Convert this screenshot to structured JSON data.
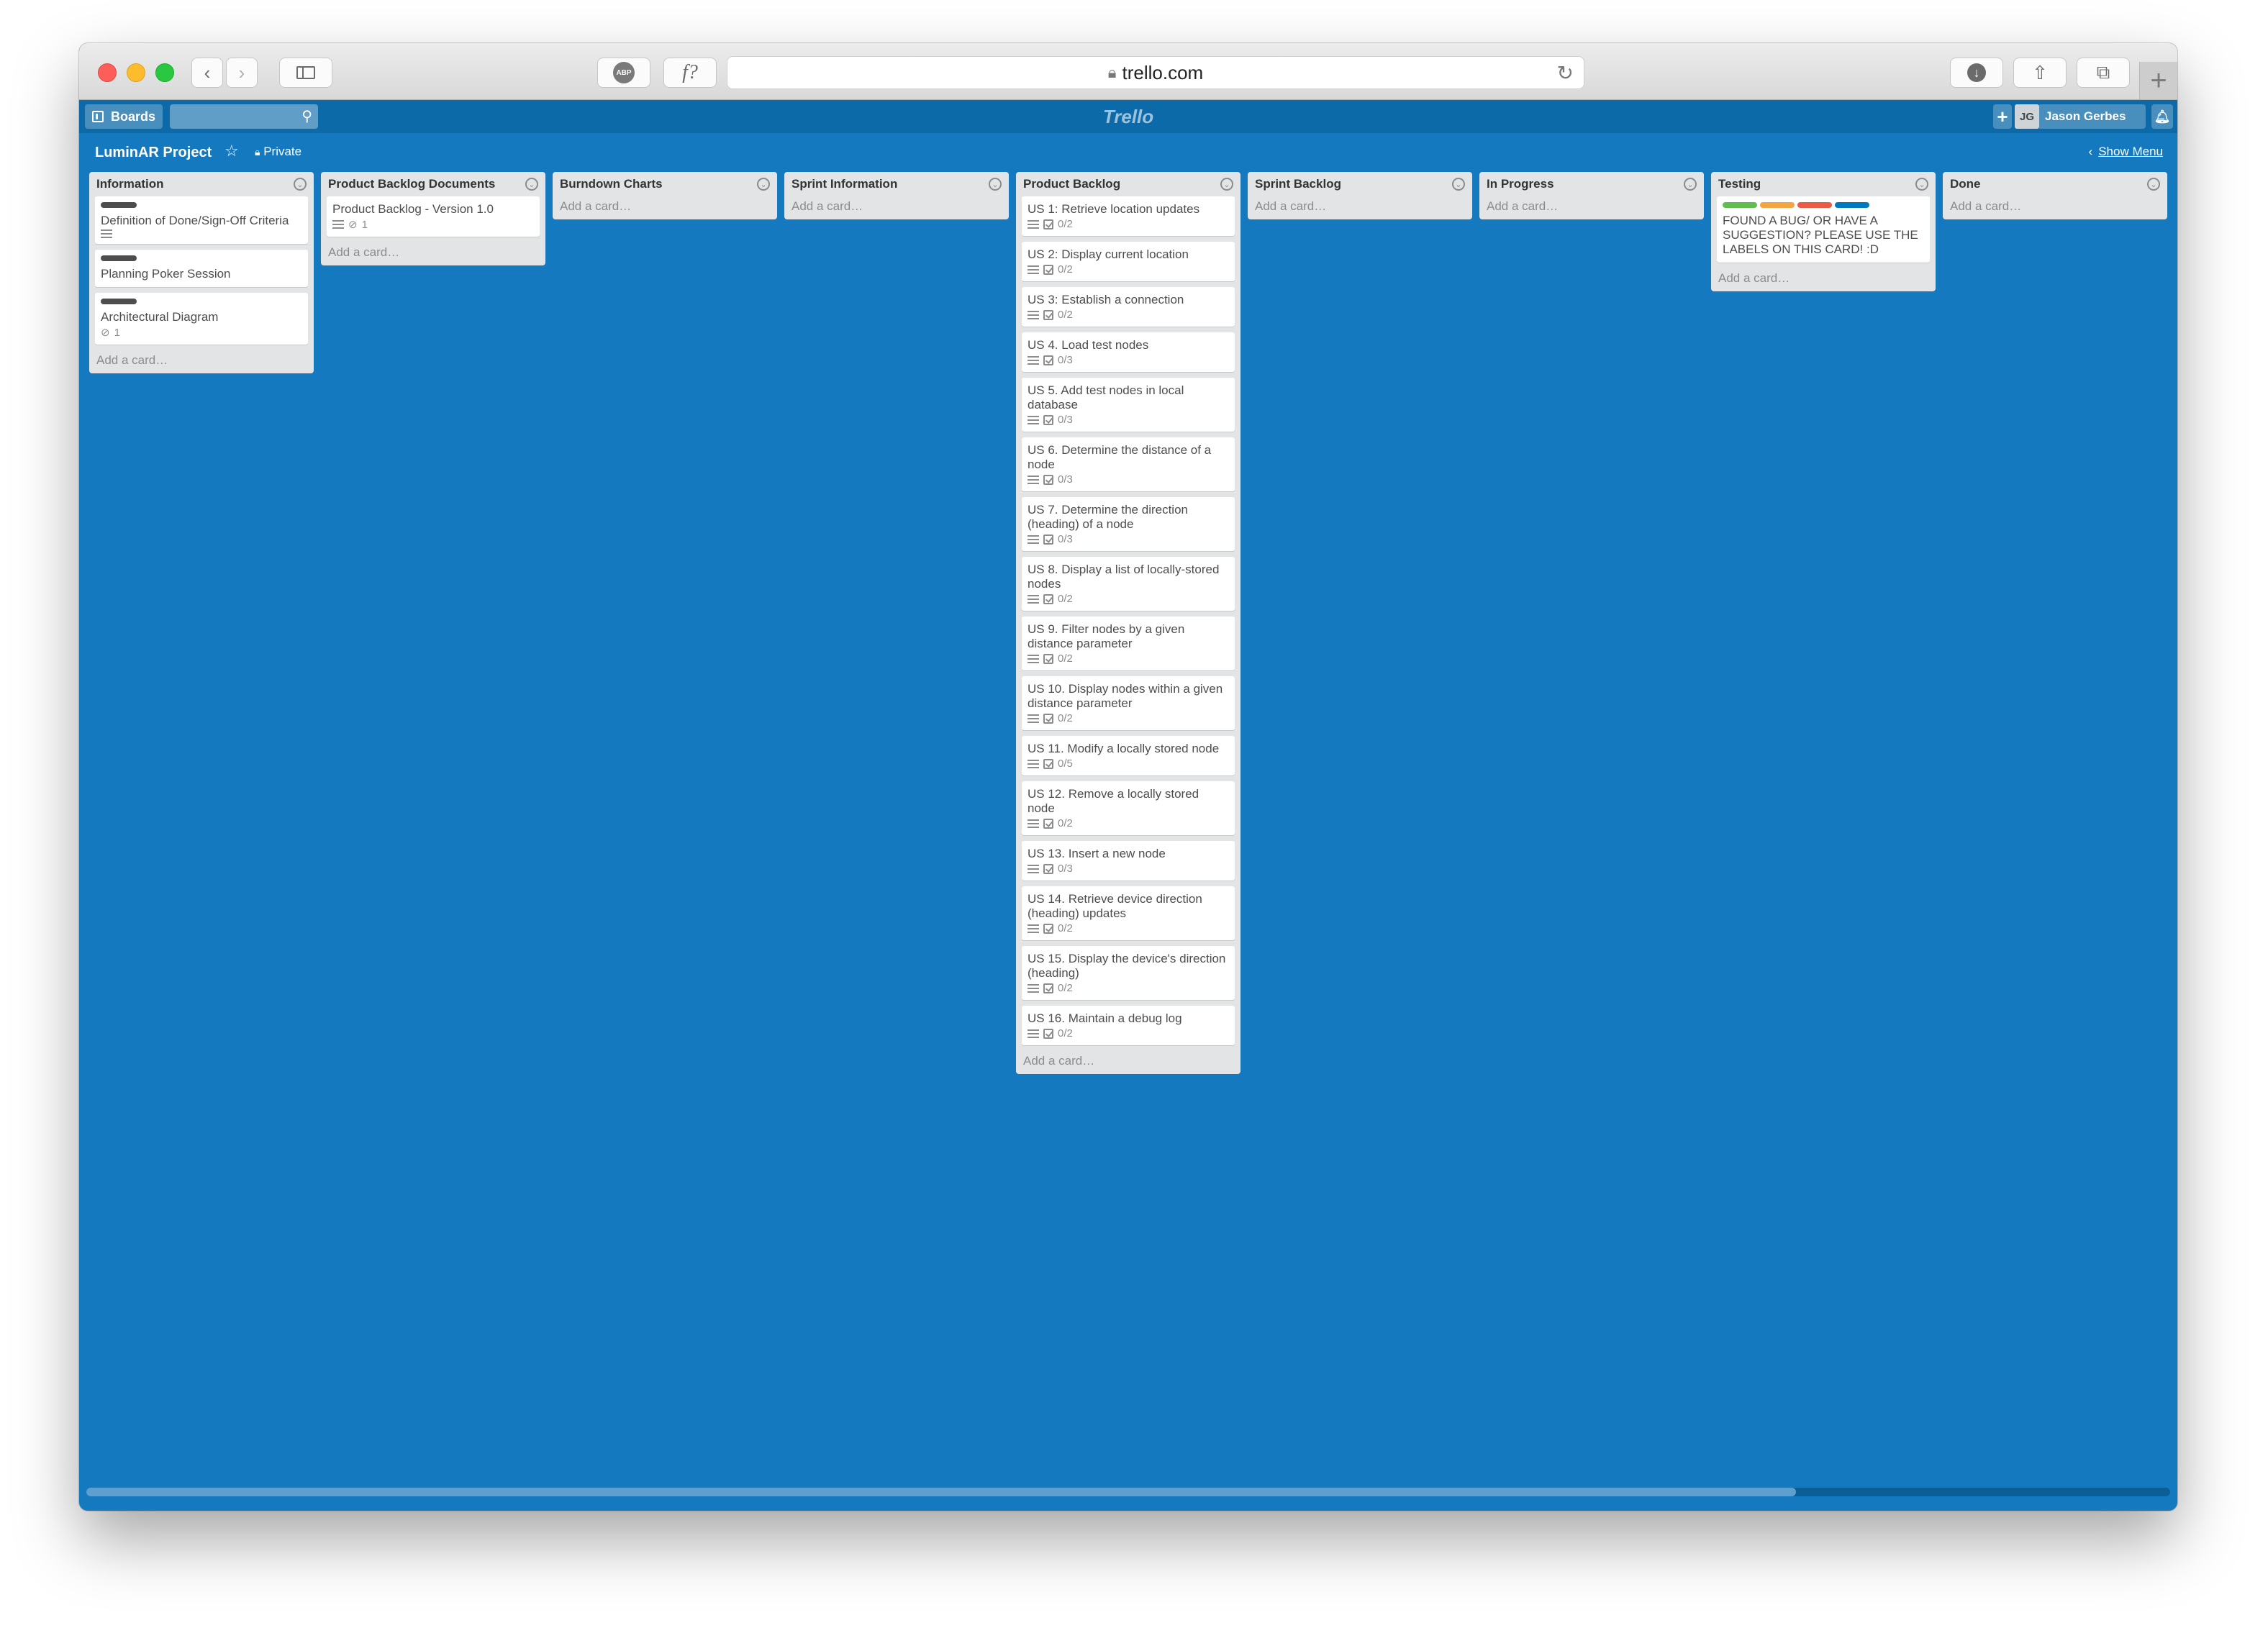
{
  "browser": {
    "url": "trello.com",
    "extension_abp": "ABP",
    "extension_f": "f?"
  },
  "header": {
    "boards_label": "Boards",
    "logo": "Trello",
    "avatar_initials": "JG",
    "user_name": "Jason Gerbes"
  },
  "board": {
    "title": "LuminAR Project",
    "visibility": "Private",
    "show_menu": "Show Menu"
  },
  "add_card": "Add a card…",
  "label_colors": [
    "#61bd4f",
    "#f2a541",
    "#eb5a46",
    "#0079bf"
  ],
  "lists": [
    {
      "title": "Information",
      "cards": [
        {
          "title": "Definition of Done/Sign-Off Criteria",
          "label": true,
          "desc": true
        },
        {
          "title": "Planning Poker Session",
          "label": true
        },
        {
          "title": "Architectural Diagram",
          "label": true,
          "attachments": "1"
        }
      ]
    },
    {
      "title": "Product Backlog Documents",
      "cards": [
        {
          "title": "Product Backlog - Version 1.0",
          "desc": true,
          "attachments": "1"
        }
      ]
    },
    {
      "title": "Burndown Charts",
      "cards": []
    },
    {
      "title": "Sprint Information",
      "cards": []
    },
    {
      "title": "Product Backlog",
      "cards": [
        {
          "title": "US 1: Retrieve location updates",
          "desc": true,
          "checklist": "0/2"
        },
        {
          "title": "US 2: Display current location",
          "desc": true,
          "checklist": "0/2"
        },
        {
          "title": "US 3: Establish a connection",
          "desc": true,
          "checklist": "0/2"
        },
        {
          "title": "US 4. Load test nodes",
          "desc": true,
          "checklist": "0/3"
        },
        {
          "title": "US 5. Add test nodes in local database",
          "desc": true,
          "checklist": "0/3"
        },
        {
          "title": "US 6. Determine the distance of a node",
          "desc": true,
          "checklist": "0/3"
        },
        {
          "title": "US 7. Determine the direction (heading) of a node",
          "desc": true,
          "checklist": "0/3"
        },
        {
          "title": "US 8. Display a list of locally-stored nodes",
          "desc": true,
          "checklist": "0/2"
        },
        {
          "title": "US 9. Filter nodes by a given distance parameter",
          "desc": true,
          "checklist": "0/2"
        },
        {
          "title": "US 10. Display nodes within a given distance parameter",
          "desc": true,
          "checklist": "0/2"
        },
        {
          "title": "US 11. Modify a locally stored node",
          "desc": true,
          "checklist": "0/5"
        },
        {
          "title": "US 12. Remove a locally stored node",
          "desc": true,
          "checklist": "0/2"
        },
        {
          "title": "US 13. Insert a new node",
          "desc": true,
          "checklist": "0/3"
        },
        {
          "title": "US 14. Retrieve device direction (heading) updates",
          "desc": true,
          "checklist": "0/2"
        },
        {
          "title": "US 15. Display the device's direction (heading)",
          "desc": true,
          "checklist": "0/2"
        },
        {
          "title": "US 16. Maintain a debug log",
          "desc": true,
          "checklist": "0/2"
        }
      ]
    },
    {
      "title": "Sprint Backlog",
      "cards": []
    },
    {
      "title": "In Progress",
      "cards": []
    },
    {
      "title": "Testing",
      "cards": [
        {
          "title": "FOUND A BUG/ OR HAVE A SUGGESTION? PLEASE USE THE LABELS ON THIS CARD! :D",
          "color_labels": true
        }
      ]
    },
    {
      "title": "Done",
      "cards": []
    }
  ]
}
